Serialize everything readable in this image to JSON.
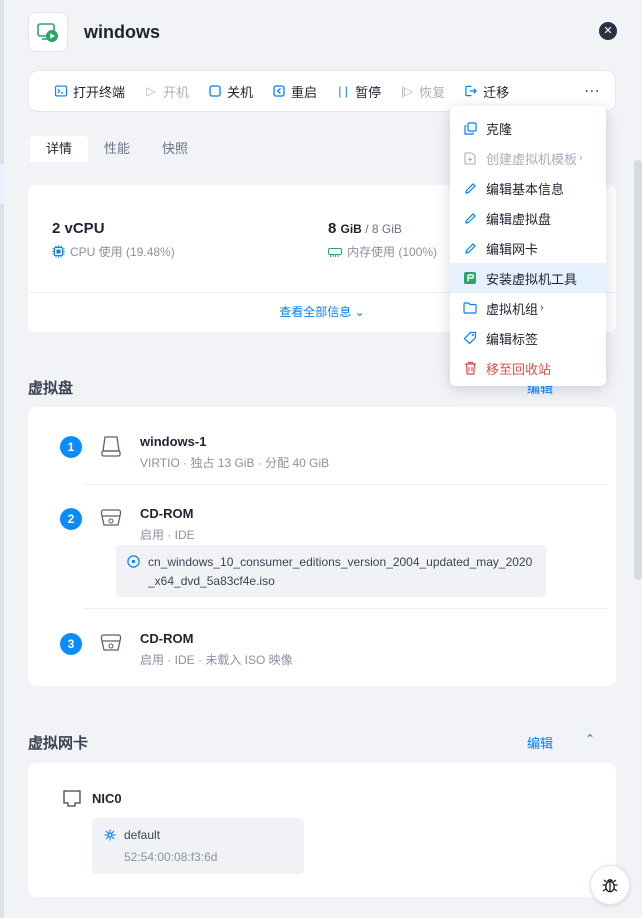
{
  "header": {
    "title": "windows"
  },
  "toolbar": {
    "buttons": [
      {
        "label": "打开终端",
        "icon": "terminal-icon",
        "enabled": true
      },
      {
        "label": "开机",
        "icon": "play-icon",
        "enabled": false
      },
      {
        "label": "关机",
        "icon": "stop-icon",
        "enabled": true
      },
      {
        "label": "重启",
        "icon": "restart-icon",
        "enabled": true
      },
      {
        "label": "暂停",
        "icon": "pause-icon",
        "enabled": true
      },
      {
        "label": "恢复",
        "icon": "resume-icon",
        "enabled": false
      },
      {
        "label": "迁移",
        "icon": "migrate-icon",
        "enabled": true
      }
    ],
    "more": "⋯"
  },
  "tabs": [
    {
      "label": "详情",
      "active": true
    },
    {
      "label": "性能",
      "active": false
    },
    {
      "label": "快照",
      "active": false
    }
  ],
  "summary": {
    "cpu": {
      "value": "2 vCPU",
      "usage_label": "CPU 使用",
      "usage_value": "(19.48%)"
    },
    "memory": {
      "used": "8",
      "used_unit": "GiB",
      "total": "8 GiB",
      "usage_label": "内存使用",
      "usage_value": "(100%)"
    },
    "view_all": "查看全部信息"
  },
  "disks_section": {
    "title": "虚拟盘",
    "edit": "编辑",
    "items": [
      {
        "index": "1",
        "name": "windows-1",
        "meta": "VIRTIO · 独占 13 GiB · 分配 40 GiB"
      },
      {
        "index": "2",
        "name": "CD-ROM",
        "meta": "启用 · IDE",
        "iso": "cn_windows_10_consumer_editions_version_2004_updated_may_2020_x64_dvd_5a83cf4e.iso"
      },
      {
        "index": "3",
        "name": "CD-ROM",
        "meta": "启用 · IDE · 未载入 ISO 映像"
      }
    ]
  },
  "nics_section": {
    "title": "虚拟网卡",
    "edit": "编辑",
    "items": [
      {
        "name": "NIC0",
        "network": "default",
        "mac": "52:54:00:08:f3:6d"
      }
    ]
  },
  "menu": {
    "items": [
      {
        "label": "克隆",
        "icon": "clone-icon"
      },
      {
        "label": "创建虚拟机模板",
        "icon": "template-icon",
        "disabled": true,
        "submenu": true
      },
      {
        "label": "编辑基本信息",
        "icon": "pencil-icon"
      },
      {
        "label": "编辑虚拟盘",
        "icon": "pencil-icon"
      },
      {
        "label": "编辑网卡",
        "icon": "pencil-icon"
      },
      {
        "label": "安装虚拟机工具",
        "icon": "vm-tools-icon",
        "hovered": true
      },
      {
        "label": "虚拟机组",
        "icon": "folder-icon",
        "submenu": true
      },
      {
        "label": "编辑标签",
        "icon": "tag-icon"
      },
      {
        "label": "移至回收站",
        "icon": "trash-icon",
        "danger": true
      }
    ]
  },
  "colors": {
    "accent": "#0080ff",
    "danger": "#e5484d",
    "hover": "#e6f1ff",
    "badge": "#0a8cff"
  }
}
